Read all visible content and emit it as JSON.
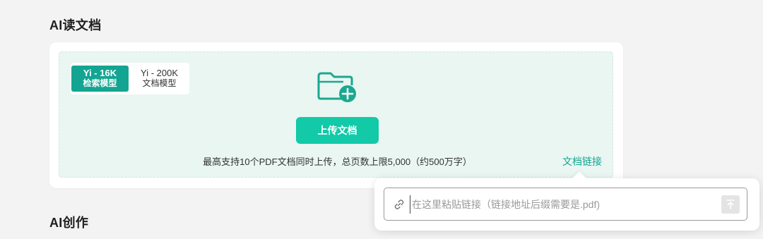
{
  "sections": {
    "read_doc_title": "AI读文档",
    "create_title": "AI创作"
  },
  "model_switch": {
    "options": [
      {
        "name": "Yi - 16K",
        "desc": "检索模型",
        "selected": true
      },
      {
        "name": "Yi - 200K",
        "desc": "文档模型",
        "selected": false
      }
    ]
  },
  "upload": {
    "button_label": "上传文档",
    "limits_text": "最高支持10个PDF文档同时上传，总页数上限5,000（约500万字）",
    "doc_link_label": "文档链接",
    "icon": "folder-add-icon"
  },
  "link_popover": {
    "placeholder": "在这里粘贴链接（链接地址后缀需要是.pdf)",
    "value": "",
    "link_icon": "link-icon",
    "submit_icon": "upload-arrow-icon"
  },
  "colors": {
    "accent": "#13a592",
    "button": "#12c9a8",
    "drop_zone_bg": "#e9f6f1",
    "page_bg": "#f3f3f3"
  }
}
